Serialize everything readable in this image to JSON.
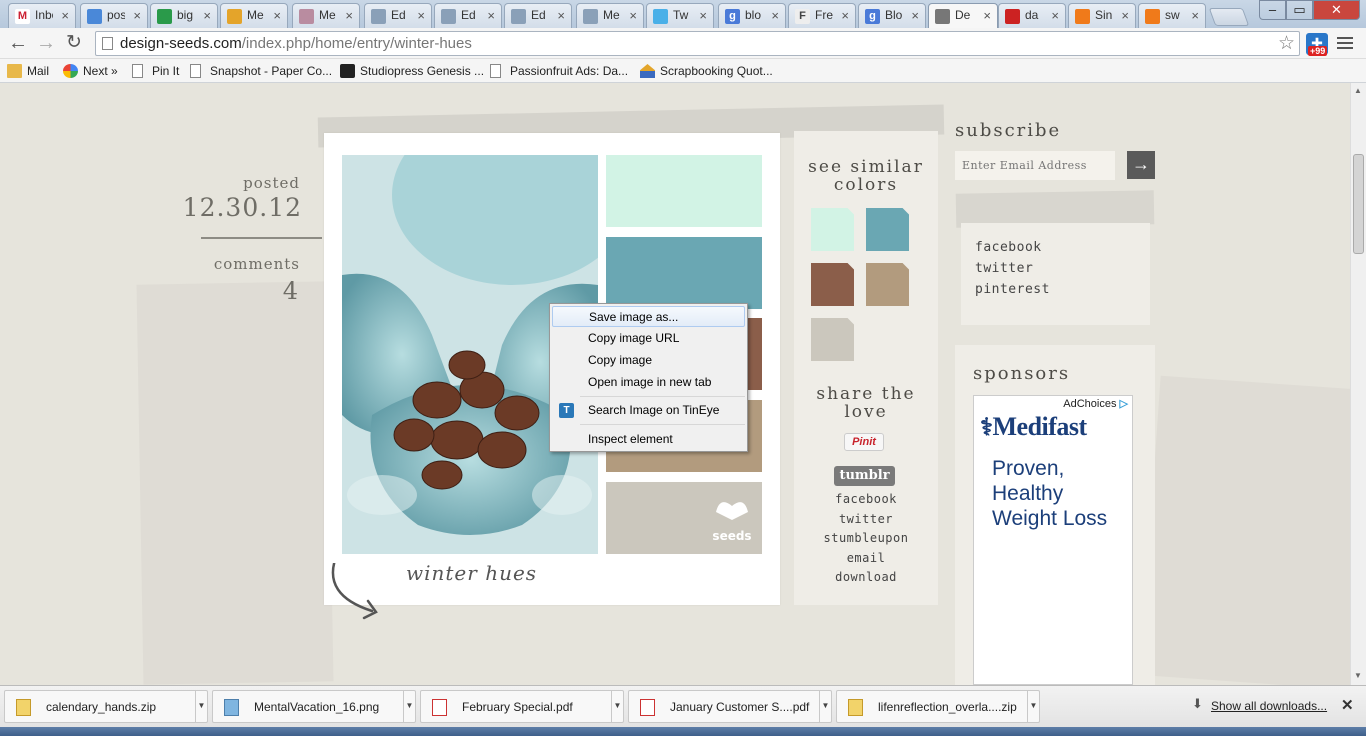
{
  "tabs": [
    {
      "label": "Inbox",
      "fav": "#fff",
      "mark": "M",
      "mcolor": "#c23"
    },
    {
      "label": "pos",
      "fav": "#4a88d8",
      "mark": "",
      "mcolor": "#fff"
    },
    {
      "label": "big",
      "fav": "#2a9a4a",
      "mark": "",
      "mcolor": "#fff"
    },
    {
      "label": "Me",
      "fav": "#e4a42a",
      "mark": "",
      "mcolor": "#fff"
    },
    {
      "label": "Me",
      "fav": "#b98ca0",
      "mark": "",
      "mcolor": "#fff"
    },
    {
      "label": "Ed",
      "fav": "#8aa0b8",
      "mark": "",
      "mcolor": "#fff"
    },
    {
      "label": "Ed",
      "fav": "#8aa0b8",
      "mark": "",
      "mcolor": "#fff"
    },
    {
      "label": "Ed",
      "fav": "#8aa0b8",
      "mark": "",
      "mcolor": "#fff"
    },
    {
      "label": "Me",
      "fav": "#8aa0b8",
      "mark": "",
      "mcolor": "#fff"
    },
    {
      "label": "Tw",
      "fav": "#4ab0e8",
      "mark": "",
      "mcolor": "#fff"
    },
    {
      "label": "blo",
      "fav": "#4a7ad8",
      "mark": "g",
      "mcolor": "#fff"
    },
    {
      "label": "Fre",
      "fav": "#eee",
      "mark": "F",
      "mcolor": "#444"
    },
    {
      "label": "Blo",
      "fav": "#4a7ad8",
      "mark": "g",
      "mcolor": "#fff"
    },
    {
      "label": "De",
      "fav": "#777",
      "mark": "",
      "mcolor": "#fff",
      "active": true
    },
    {
      "label": "da",
      "fav": "#c22",
      "mark": "",
      "mcolor": "#fff"
    },
    {
      "label": "Sin",
      "fav": "#f07a1a",
      "mark": "",
      "mcolor": "#fff"
    },
    {
      "label": "sw",
      "fav": "#f07a1a",
      "mark": "",
      "mcolor": "#fff"
    }
  ],
  "window_controls": {
    "minimize": "–",
    "maximize": "▭",
    "close": "✕"
  },
  "url": {
    "host": "design-seeds.com",
    "path": "/index.php/home/entry/winter-hues"
  },
  "extension_badge": "+99",
  "bookmarks": [
    {
      "label": "Mail",
      "icon": "folder-icon"
    },
    {
      "label": "Next »",
      "icon": "google-icon"
    },
    {
      "label": "Pin It",
      "icon": "page-icon"
    },
    {
      "label": "Snapshot - Paper Co...",
      "icon": "page-icon"
    },
    {
      "label": "Studiopress Genesis ...",
      "icon": "genesis-icon"
    },
    {
      "label": "Passionfruit Ads: Da...",
      "icon": "page-icon"
    },
    {
      "label": "Scrapbooking Quot...",
      "icon": "scrapbook-icon"
    }
  ],
  "post": {
    "posted_label": "posted",
    "date": "12.30.12",
    "comments_label": "comments",
    "comments_count": "4",
    "title": "winter hues",
    "logo_text": "seeds"
  },
  "palette": [
    "#d2f3e5",
    "#6aa7b3",
    "#8b5e4a",
    "#b29b7e",
    "#cbc7bd"
  ],
  "sidebar": {
    "similar_heading_line1": "see similar",
    "similar_heading_line2": "colors",
    "share_heading_line1": "share the",
    "share_heading_line2": "love",
    "pinit": "Pinit",
    "tumblr": "tumblr",
    "share_links": [
      "facebook",
      "twitter",
      "stumbleupon",
      "email",
      "download"
    ]
  },
  "subscribe": {
    "heading": "subscribe",
    "placeholder": "Enter Email Address",
    "go": "→"
  },
  "social": [
    "facebook",
    "twitter",
    "pinterest"
  ],
  "sponsors": {
    "heading": "sponsors",
    "adchoices": "AdChoices",
    "brand": "Medifast",
    "line1": "Proven,",
    "line2": "Healthy",
    "line3": "Weight Loss"
  },
  "context_menu": [
    "Save image as...",
    "Copy image URL",
    "Copy image",
    "Open image in new tab",
    "Search Image on TinEye",
    "Inspect element"
  ],
  "tineye_mark": "T",
  "downloads": [
    {
      "name": "calendary_hands.zip",
      "type": "zip"
    },
    {
      "name": "MentalVacation_16.png",
      "type": "png"
    },
    {
      "name": "February Special.pdf",
      "type": "pdf"
    },
    {
      "name": "January Customer S....pdf",
      "type": "pdf"
    },
    {
      "name": "lifenreflection_overla....zip",
      "type": "zip"
    }
  ],
  "show_all_downloads": "Show all downloads..."
}
